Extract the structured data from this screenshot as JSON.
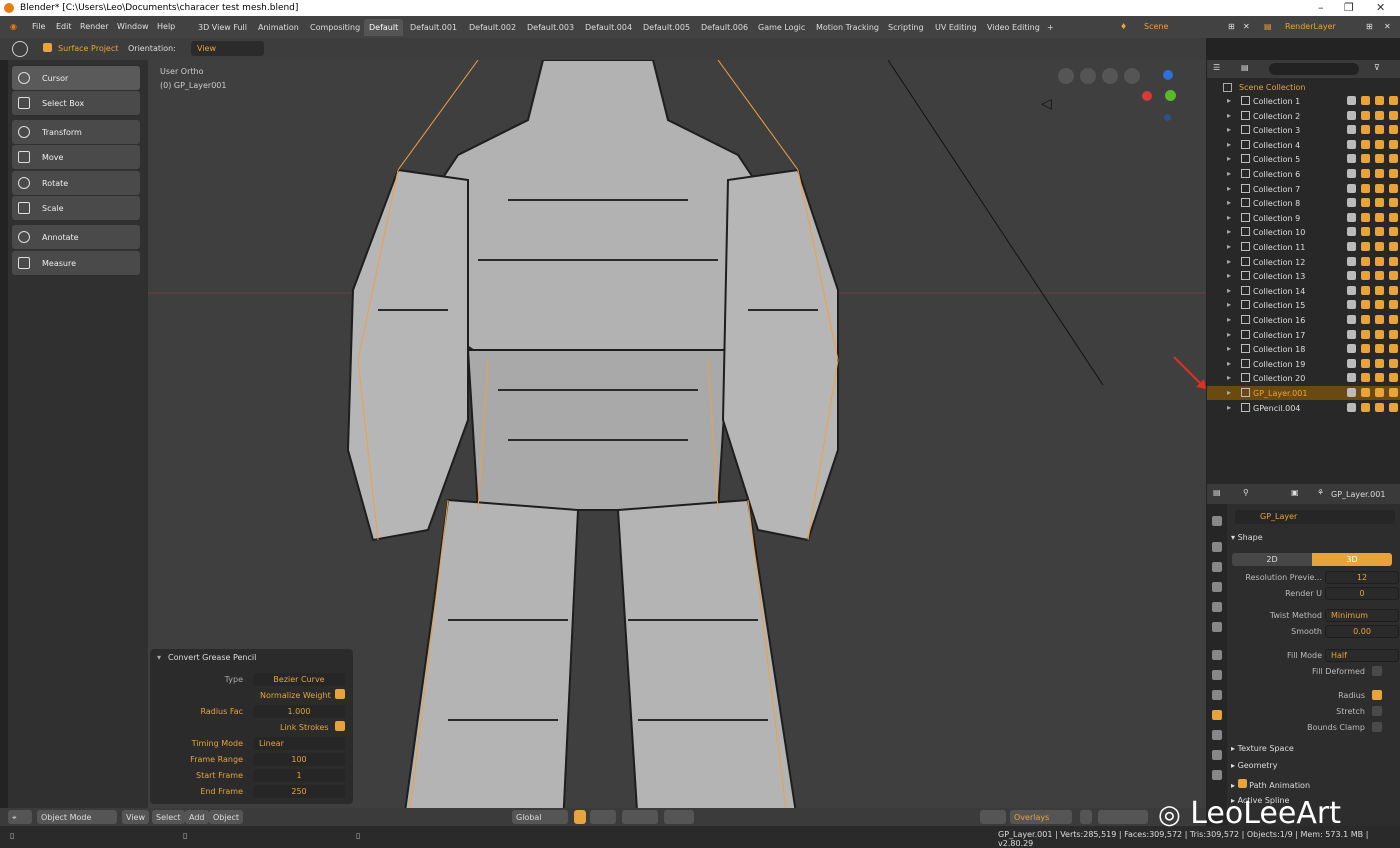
{
  "window": {
    "title": "Blender* [C:\\Users\\Leo\\Documents\\characer test mesh.blend]"
  },
  "menu": [
    "File",
    "Edit",
    "Render",
    "Window",
    "Help"
  ],
  "workspaces": [
    "3D View Full",
    "Animation",
    "Compositing",
    "Default",
    "Default.001",
    "Default.002",
    "Default.003",
    "Default.004",
    "Default.005",
    "Default.006",
    "Game Logic",
    "Motion Tracking",
    "Scripting",
    "UV Editing",
    "Video Editing"
  ],
  "active_workspace": "Default",
  "scene": {
    "name": "Scene",
    "render_layer": "RenderLayer"
  },
  "tool_header": {
    "surface_project": "Surface Project",
    "orientation_label": "Orientation:",
    "orientation_value": "View"
  },
  "viewport": {
    "view_name": "User Ortho",
    "object_info": "(0) GP_Layer001"
  },
  "tools": [
    "Cursor",
    "Select Box",
    "Transform",
    "Move",
    "Rotate",
    "Scale",
    "Annotate",
    "Measure"
  ],
  "operator_panel": {
    "title": "Convert Grease Pencil",
    "type_label": "Type",
    "type_value": "Bezier Curve",
    "normalize_weight": "Normalize Weight",
    "radius_fac_label": "Radius Fac",
    "radius_fac_value": "1.000",
    "link_strokes": "Link Strokes",
    "timing_mode_label": "Timing Mode",
    "timing_mode_value": "Linear",
    "frame_range_label": "Frame Range",
    "frame_range_value": "100",
    "start_frame_label": "Start Frame",
    "start_frame_value": "1",
    "end_frame_label": "End Frame",
    "end_frame_value": "250"
  },
  "viewport_bottom": {
    "mode": "Object Mode",
    "menus": [
      "View",
      "Select",
      "Add",
      "Object"
    ],
    "transform_orientation": "Global",
    "overlays": "Overlays"
  },
  "outliner": {
    "root": "Scene Collection",
    "items": [
      "Collection 1",
      "Collection 2",
      "Collection 3",
      "Collection 4",
      "Collection 5",
      "Collection 6",
      "Collection 7",
      "Collection 8",
      "Collection 9",
      "Collection 10",
      "Collection 11",
      "Collection 12",
      "Collection 13",
      "Collection 14",
      "Collection 15",
      "Collection 16",
      "Collection 17",
      "Collection 18",
      "Collection 19",
      "Collection 20",
      "GP_Layer.001",
      "GPencil.004"
    ],
    "selected": "GP_Layer.001"
  },
  "properties": {
    "object_name": "GP_Layer.001",
    "data_name": "GP_Layer",
    "shape_section": "Shape",
    "dim_2d": "2D",
    "dim_3d": "3D",
    "resolution_preview_label": "Resolution Previe...",
    "resolution_preview_value": "12",
    "render_u_label": "Render U",
    "render_u_value": "0",
    "twist_method_label": "Twist Method",
    "twist_method_value": "Minimum",
    "smooth_label": "Smooth",
    "smooth_value": "0.00",
    "fill_mode_label": "Fill Mode",
    "fill_mode_value": "Half",
    "fill_deformed": "Fill Deformed",
    "radius": "Radius",
    "stretch": "Stretch",
    "bounds_clamp": "Bounds Clamp",
    "texture_space": "Texture Space",
    "geometry": "Geometry",
    "path_animation": "Path Animation",
    "active_spline": "Active Spline"
  },
  "status": {
    "text": "GP_Layer.001 | Verts:285,519 | Faces:309,572 | Tris:309,572 | Objects:1/9 | Mem: 573.1 MB | v2.80.29"
  },
  "watermark": "LeoLeeArt",
  "colors": {
    "accent": "#e8a33a",
    "selected_row": "#6b4a12",
    "mesh": "#b8b8b8",
    "outline": "#f0a040"
  }
}
